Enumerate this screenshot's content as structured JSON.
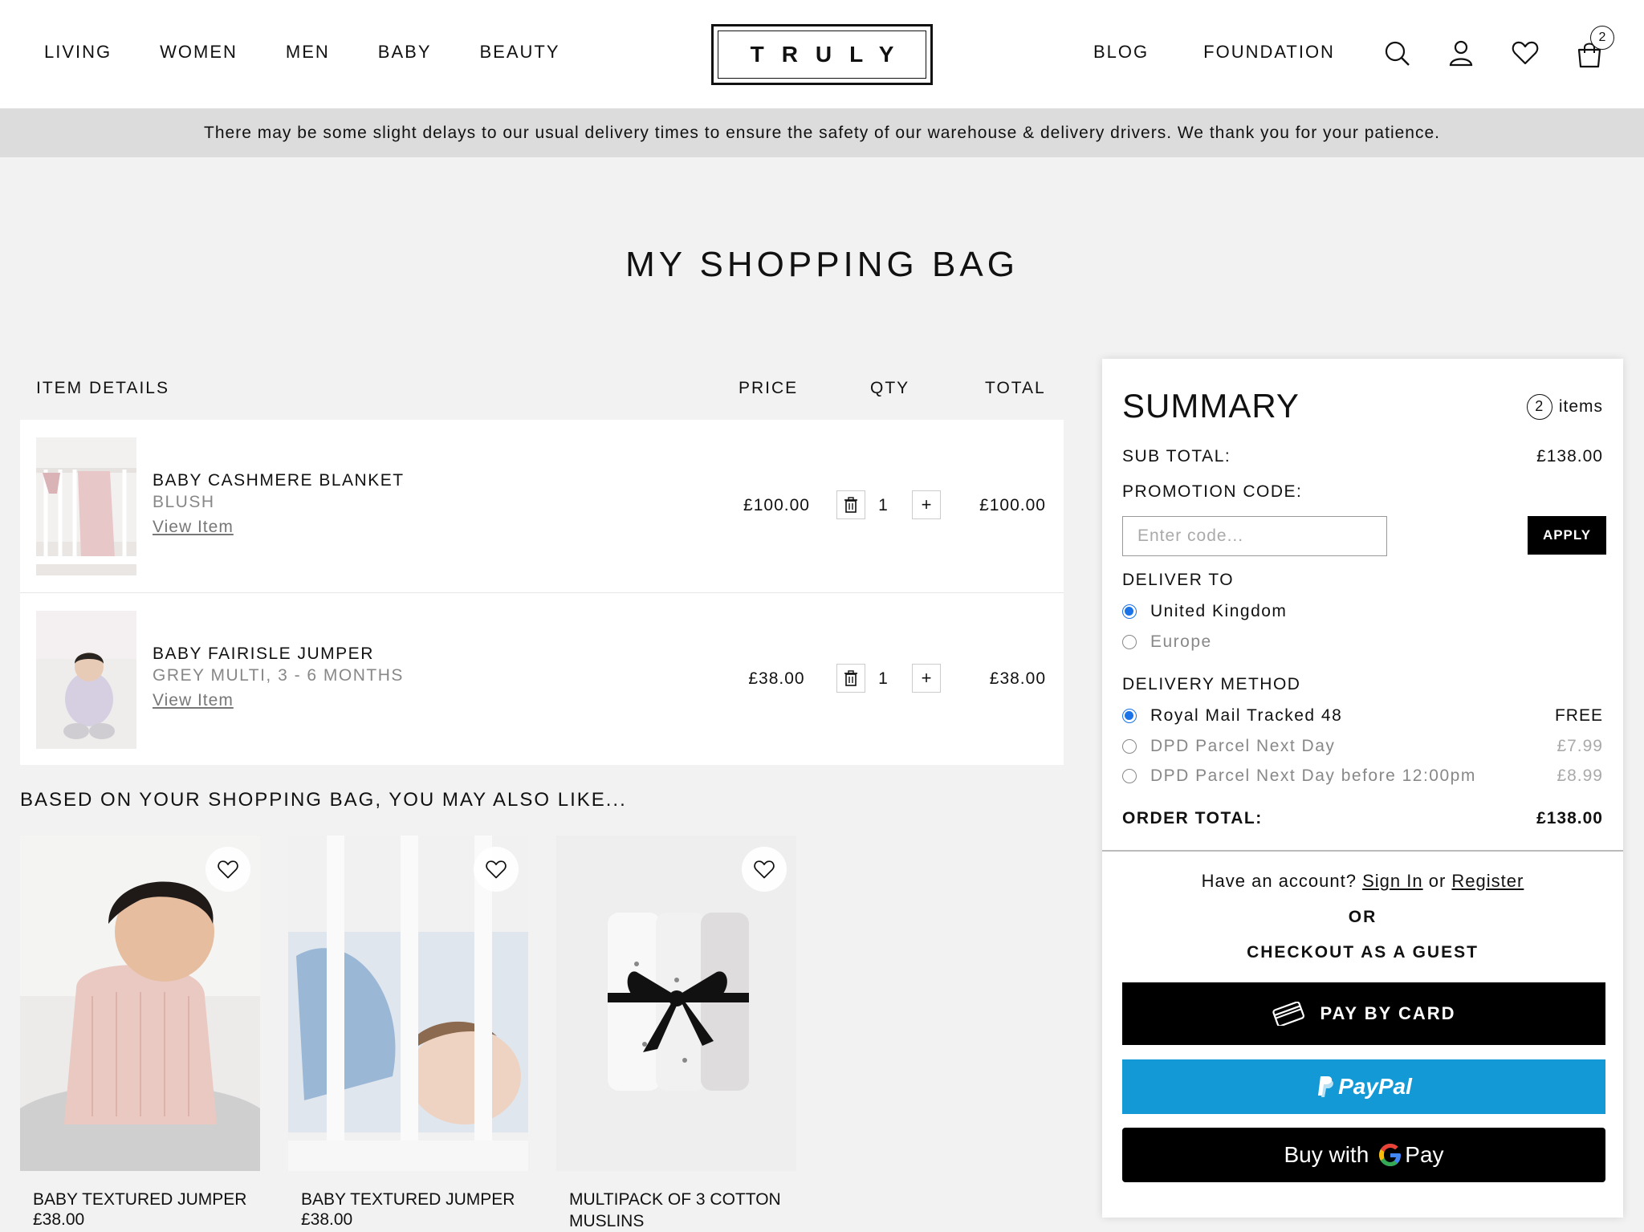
{
  "header": {
    "nav_left": [
      "LIVING",
      "WOMEN",
      "MEN",
      "BABY",
      "BEAUTY"
    ],
    "logo": "TRULY",
    "nav_right": [
      "BLOG",
      "FOUNDATION"
    ],
    "cart_count": "2",
    "icons": [
      "search-icon",
      "account-icon",
      "heart-icon",
      "cart-icon"
    ]
  },
  "announcement": "There may be some slight delays to our usual delivery times to ensure the safety of our warehouse & delivery drivers. We thank you for your patience.",
  "page_title": "MY SHOPPING BAG",
  "table": {
    "headers": {
      "item": "ITEM DETAILS",
      "price": "PRICE",
      "qty": "QTY",
      "total": "TOTAL"
    },
    "items": [
      {
        "name": "BABY CASHMERE BLANKET",
        "variant": "BLUSH",
        "link": "View Item",
        "price": "£100.00",
        "qty": "1",
        "total": "£100.00"
      },
      {
        "name": "BABY FAIRISLE JUMPER",
        "variant": "GREY MULTI, 3 - 6 MONTHS",
        "link": "View Item",
        "price": "£38.00",
        "qty": "1",
        "total": "£38.00"
      }
    ]
  },
  "recommendations": {
    "title": "BASED ON YOUR SHOPPING BAG, YOU MAY ALSO LIKE...",
    "items": [
      {
        "name": "BABY TEXTURED JUMPER",
        "price": "£38.00"
      },
      {
        "name": "BABY TEXTURED JUMPER",
        "price": "£38.00"
      },
      {
        "name": "MULTIPACK OF 3 COTTON MUSLINS",
        "price": ""
      }
    ]
  },
  "summary": {
    "title": "SUMMARY",
    "count": "2",
    "count_label": "items",
    "subtotal_label": "SUB TOTAL:",
    "subtotal": "£138.00",
    "promo_label": "PROMOTION CODE:",
    "promo_placeholder": "Enter code...",
    "promo_value": "",
    "apply": "APPLY",
    "deliver_to_label": "DELIVER TO",
    "deliver_options": [
      {
        "label": "United Kingdom",
        "selected": true
      },
      {
        "label": "Europe",
        "selected": false
      }
    ],
    "method_label": "DELIVERY METHOD",
    "methods": [
      {
        "label": "Royal Mail Tracked 48",
        "price": "FREE",
        "selected": true
      },
      {
        "label": "DPD Parcel Next Day",
        "price": "£7.99",
        "selected": false
      },
      {
        "label": "DPD Parcel Next Day before 12:00pm",
        "price": "£8.99",
        "selected": false
      }
    ],
    "order_total_label": "ORDER TOTAL:",
    "order_total": "£138.00",
    "account_prefix": "Have an account?",
    "sign_in": "Sign In",
    "or_text": "or",
    "register": "Register",
    "or_upper": "OR",
    "guest": "CHECKOUT AS A GUEST",
    "pay_card": "PAY BY CARD",
    "paypal": "PayPal",
    "gpay_prefix": "Buy with",
    "gpay_pay": "Pay",
    "colors": {
      "paypal": "#139ad6",
      "radio": "#1a73e8",
      "black": "#000000"
    }
  }
}
